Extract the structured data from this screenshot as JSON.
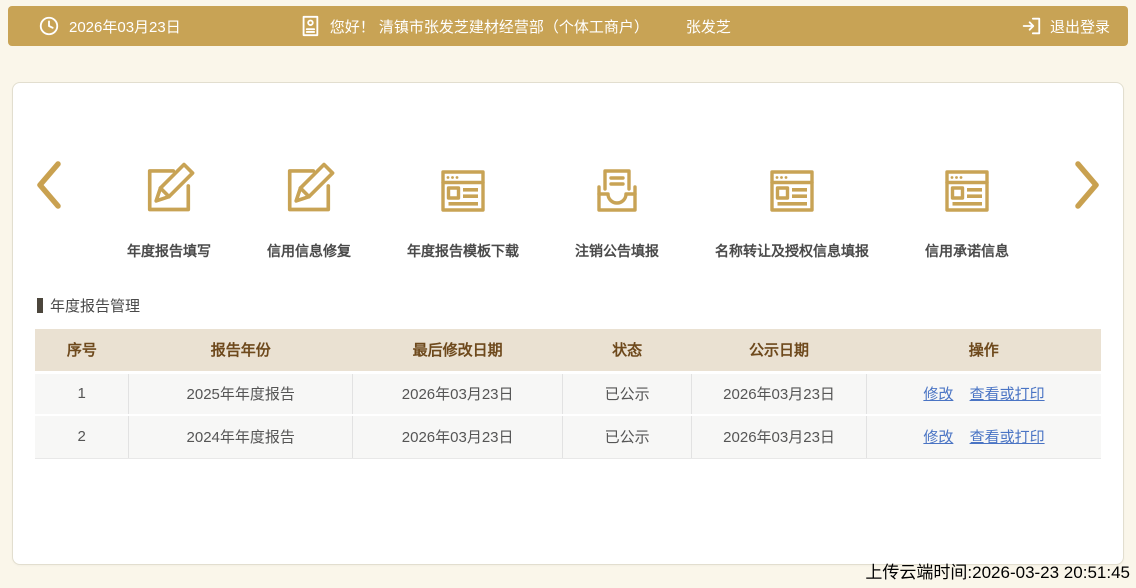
{
  "header": {
    "date": "2026年03月23日",
    "greeting": "您好！ 清镇市张发芝建材经营部（个体工商户）",
    "username": "张发芝",
    "logout_label": "退出登录"
  },
  "carousel": {
    "items": [
      {
        "label": "年度报告填写",
        "icon": "edit-pencil-icon"
      },
      {
        "label": "信用信息修复",
        "icon": "edit-pencil-icon"
      },
      {
        "label": "年度报告模板下载",
        "icon": "webpage-icon"
      },
      {
        "label": "注销公告填报",
        "icon": "inbox-paper-icon"
      },
      {
        "label": "名称转让及授权信息填报",
        "icon": "webpage-icon"
      },
      {
        "label": "信用承诺信息",
        "icon": "webpage-icon"
      }
    ]
  },
  "section": {
    "title": "年度报告管理"
  },
  "table": {
    "headers": [
      "序号",
      "报告年份",
      "最后修改日期",
      "状态",
      "公示日期",
      "操作"
    ],
    "rows": [
      {
        "seq": "1",
        "year": "2025年年度报告",
        "modified": "2026年03月23日",
        "status": "已公示",
        "publish_date": "2026年03月23日",
        "actions": [
          "修改",
          "查看或打印"
        ]
      },
      {
        "seq": "2",
        "year": "2024年年度报告",
        "modified": "2026年03月23日",
        "status": "已公示",
        "publish_date": "2026年03月23日",
        "actions": [
          "修改",
          "查看或打印"
        ]
      }
    ]
  },
  "footer": {
    "upload_time": "上传云端时间:2026-03-23 20:51:45"
  },
  "colors": {
    "accent_gold": "#C8A355",
    "link_blue": "#4A74C4",
    "table_header_bg": "#EAE1D2",
    "table_header_text": "#6E491C",
    "page_background": "#FAF6EA"
  }
}
